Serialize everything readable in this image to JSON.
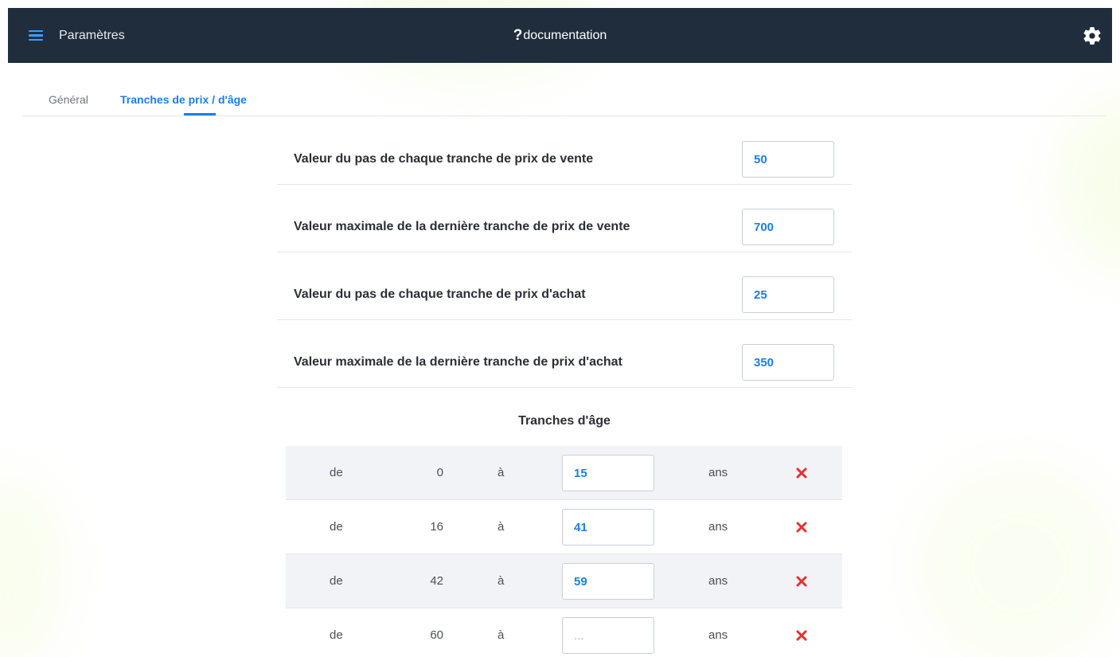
{
  "header": {
    "app_title": "Paramètres",
    "doc_icon": "?",
    "doc_label": "documentation",
    "menu_icon": "hamburger-menu-icon",
    "settings_icon": "gear-icon",
    "background_color": "#1f2d3d",
    "accent_color": "#3aa0ff"
  },
  "tabs": [
    {
      "label": "Général",
      "active": false
    },
    {
      "label": "Tranches de prix / d'âge",
      "active": true
    }
  ],
  "settings": [
    {
      "label": "Valeur du pas de chaque tranche de prix de vente",
      "value": "50"
    },
    {
      "label": "Valeur maximale de la dernière tranche de prix de vente",
      "value": "700"
    },
    {
      "label": "Valeur du pas de chaque tranche de prix d'achat",
      "value": "25"
    },
    {
      "label": "Valeur maximale de la dernière tranche de prix d'achat",
      "value": "350"
    }
  ],
  "age_ranges": {
    "title": "Tranches d'âge",
    "from_label": "de",
    "to_label": "à",
    "unit_label": "ans",
    "placeholder": "...",
    "delete_icon": "delete-x-icon",
    "delete_color": "#e5322d",
    "rows": [
      {
        "from": "0",
        "to": "15"
      },
      {
        "from": "16",
        "to": "41"
      },
      {
        "from": "42",
        "to": "59"
      },
      {
        "from": "60",
        "to": ""
      }
    ]
  }
}
